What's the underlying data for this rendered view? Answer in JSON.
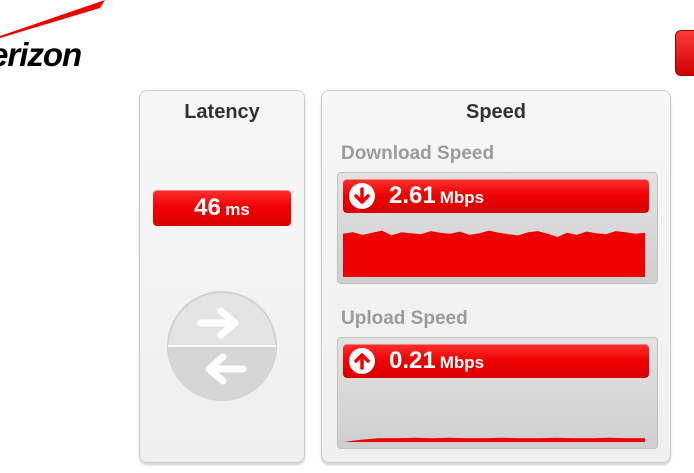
{
  "brand": {
    "logo_text": "erizon",
    "accent_color": "#ee0000"
  },
  "latency": {
    "title": "Latency",
    "value": "46",
    "unit": "ms",
    "icon": "transfer-arrows-icon"
  },
  "speed": {
    "title": "Speed",
    "download": {
      "label": "Download Speed",
      "value": "2.61",
      "unit": "Mbps",
      "icon": "arrow-down-icon",
      "graph_samples": [
        0.8,
        0.83,
        0.78,
        0.82,
        0.86,
        0.77,
        0.83,
        0.81,
        0.79,
        0.85,
        0.82,
        0.8,
        0.84,
        0.78,
        0.81,
        0.86,
        0.82,
        0.79,
        0.77,
        0.83,
        0.85,
        0.8,
        0.74,
        0.82,
        0.78,
        0.84,
        0.81,
        0.79,
        0.85,
        0.83,
        0.8,
        0.82
      ]
    },
    "upload": {
      "label": "Upload Speed",
      "value": "0.21",
      "unit": "Mbps",
      "icon": "arrow-up-icon",
      "graph_samples": [
        0.0,
        0.04,
        0.07,
        0.07,
        0.08,
        0.07,
        0.08,
        0.07,
        0.07,
        0.08,
        0.07,
        0.07,
        0.08,
        0.07,
        0.07,
        0.08,
        0.07,
        0.07
      ]
    }
  }
}
